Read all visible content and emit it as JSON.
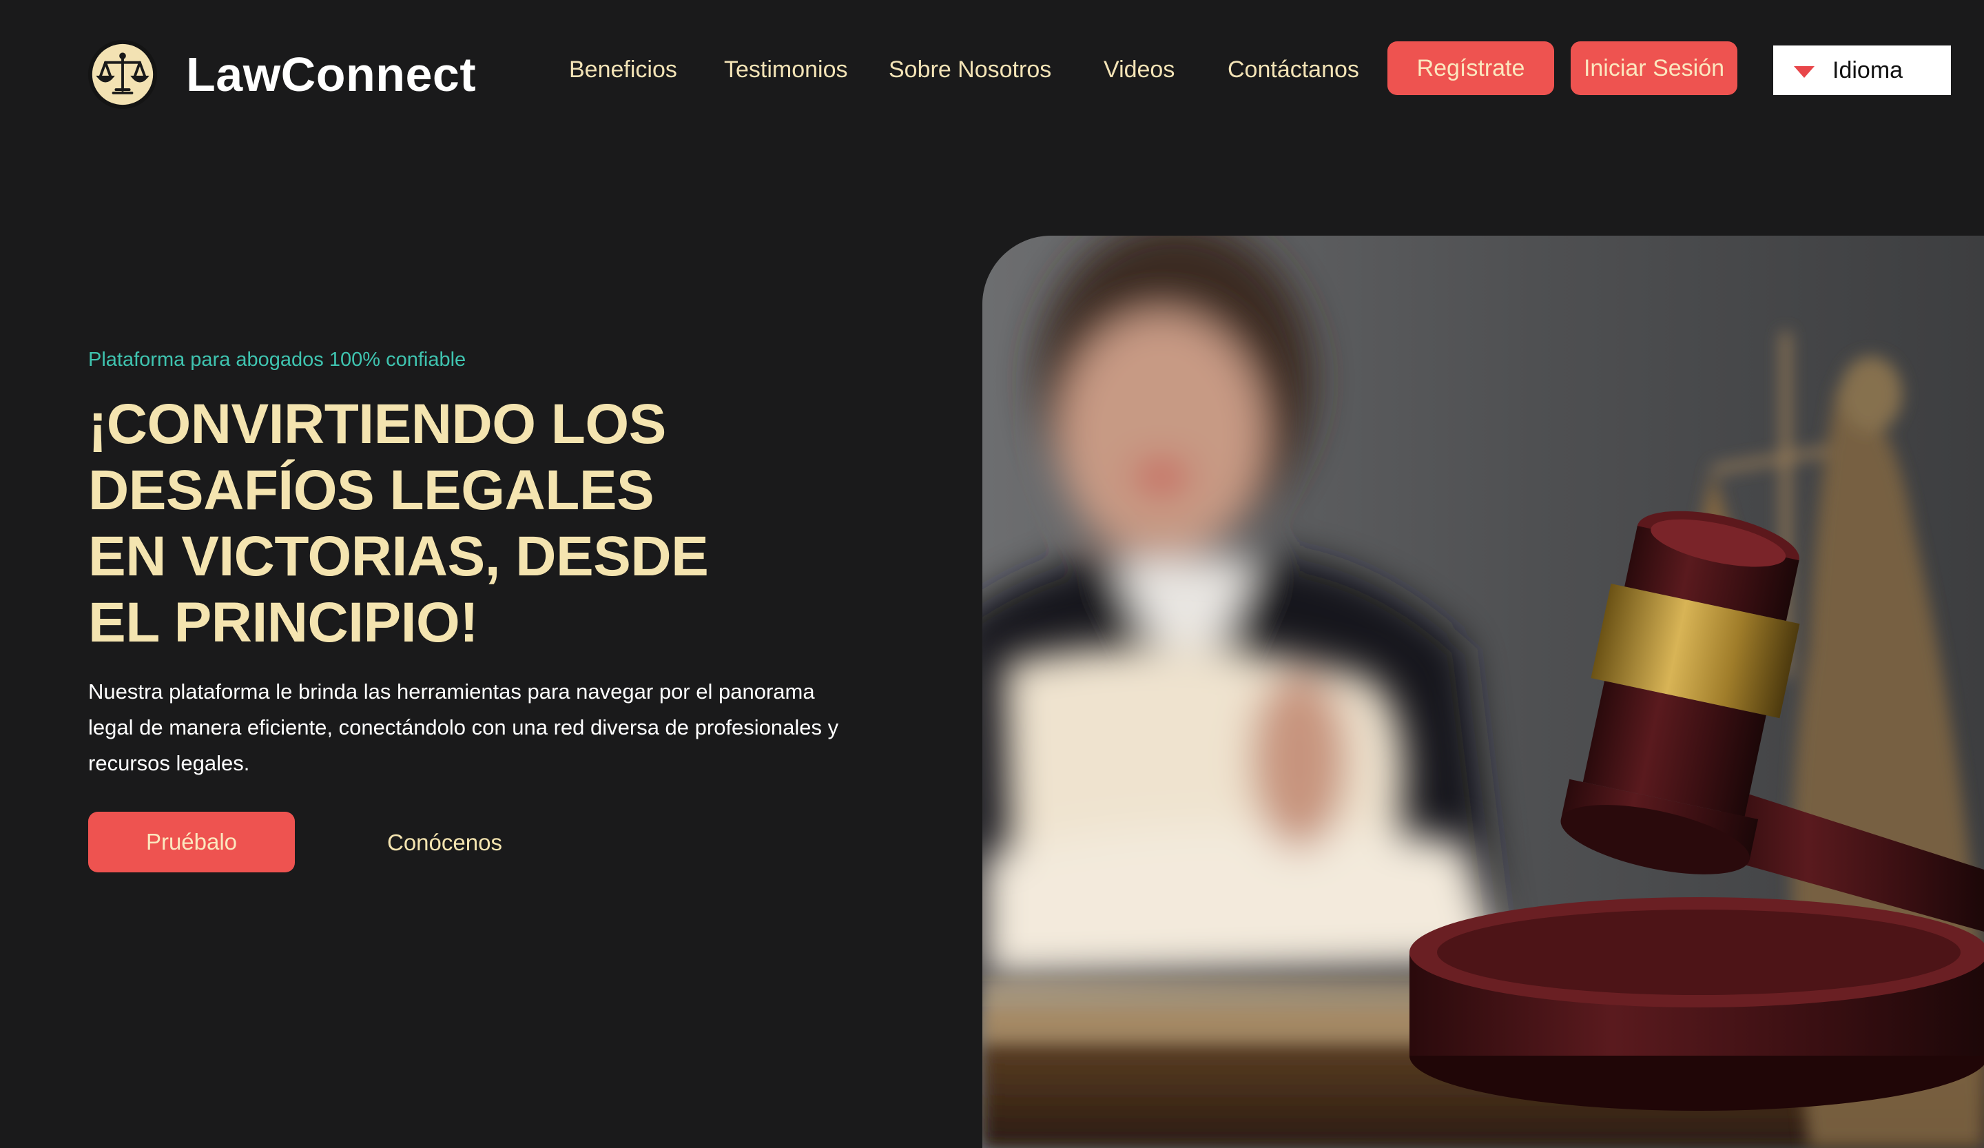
{
  "header": {
    "brand_name": "LawConnect",
    "logo_icon": "scales-of-justice-icon",
    "nav": [
      {
        "label": "Beneficios"
      },
      {
        "label": "Testimonios"
      },
      {
        "label": "Sobre Nosotros"
      },
      {
        "label": "Videos"
      },
      {
        "label": "Contáctanos"
      }
    ],
    "register_label": "Regístrate",
    "login_label": "Iniciar Sesión",
    "language": {
      "label": "Idioma",
      "icon": "caret-down-icon"
    }
  },
  "hero": {
    "tagline": "Plataforma para abogados 100% confiable",
    "headline_lines": [
      "¡CONVIRTIENDO LOS",
      "DESAFÍOS LEGALES",
      "EN VICTORIAS, DESDE",
      "EL PRINCIPIO!"
    ],
    "description": "Nuestra plataforma le brinda las herramientas para navegar por el panorama legal de manera eficiente, conectándolo con una red diversa de profesionales y recursos legales.",
    "primary_cta": "Pruébalo",
    "secondary_cta": "Conócenos"
  },
  "colors": {
    "background": "#1a1a1b",
    "accent_red": "#ee5350",
    "cream": "#f4e4b0",
    "teal": "#3fc4b0"
  }
}
